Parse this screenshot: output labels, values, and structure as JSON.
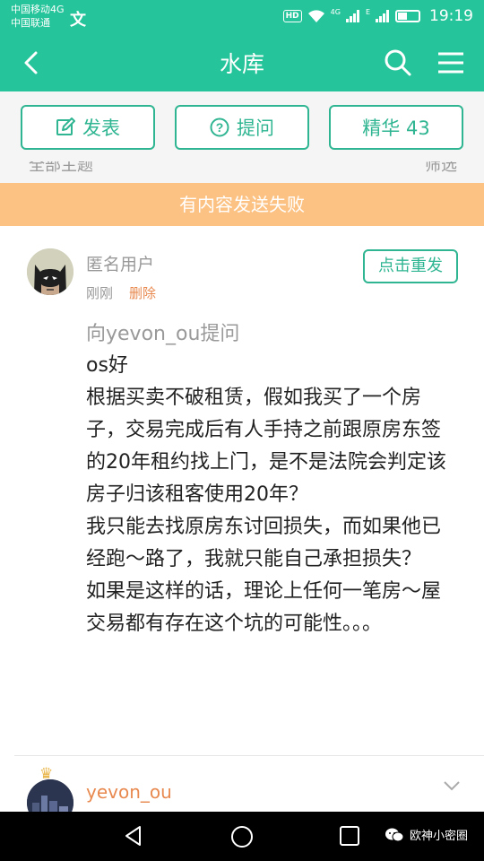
{
  "status_bar": {
    "carrier_1": "中国移动4G",
    "carrier_2": "中国联通",
    "carrier_icon": "文",
    "hd": "HD",
    "net_1": "4G",
    "net_2": "E",
    "time": "19:19"
  },
  "header": {
    "title": "水库",
    "icons": [
      "back-arrow-icon",
      "search-icon",
      "menu-icon"
    ]
  },
  "actions": {
    "post_label": "发表",
    "ask_label": "提问",
    "featured_label": "精华 43"
  },
  "sub_bar": {
    "left_text": "全部主题",
    "right_text": "筛选"
  },
  "banner": {
    "message": "有内容发送失败"
  },
  "post": {
    "username": "匿名用户",
    "time": "刚刚",
    "delete_label": "删除",
    "resend_label": "点击重发",
    "question_to": "向yevon_ou提问",
    "paragraphs": [
      "os好",
      "根据买卖不破租赁，假如我买了一个房子，交易完成后有人手持之前跟原房东签的20年租约找上门，是不是法院会判定该房子归该租客使用20年？",
      "我只能去找原房东讨回损失，而如果他已经跑～路了，我就只能自己承担损失？",
      "如果是这样的话，理论上任何一笔房～屋交易都有存在这个坑的可能性。。。"
    ]
  },
  "reply": {
    "username": "yevon_ou"
  },
  "system_nav": {
    "watermark": "欧神小密圈"
  },
  "colors": {
    "accent": "#25c49a",
    "button_border": "#2fb591",
    "banner_bg": "#fcc283",
    "orange_text": "#e8894f"
  }
}
